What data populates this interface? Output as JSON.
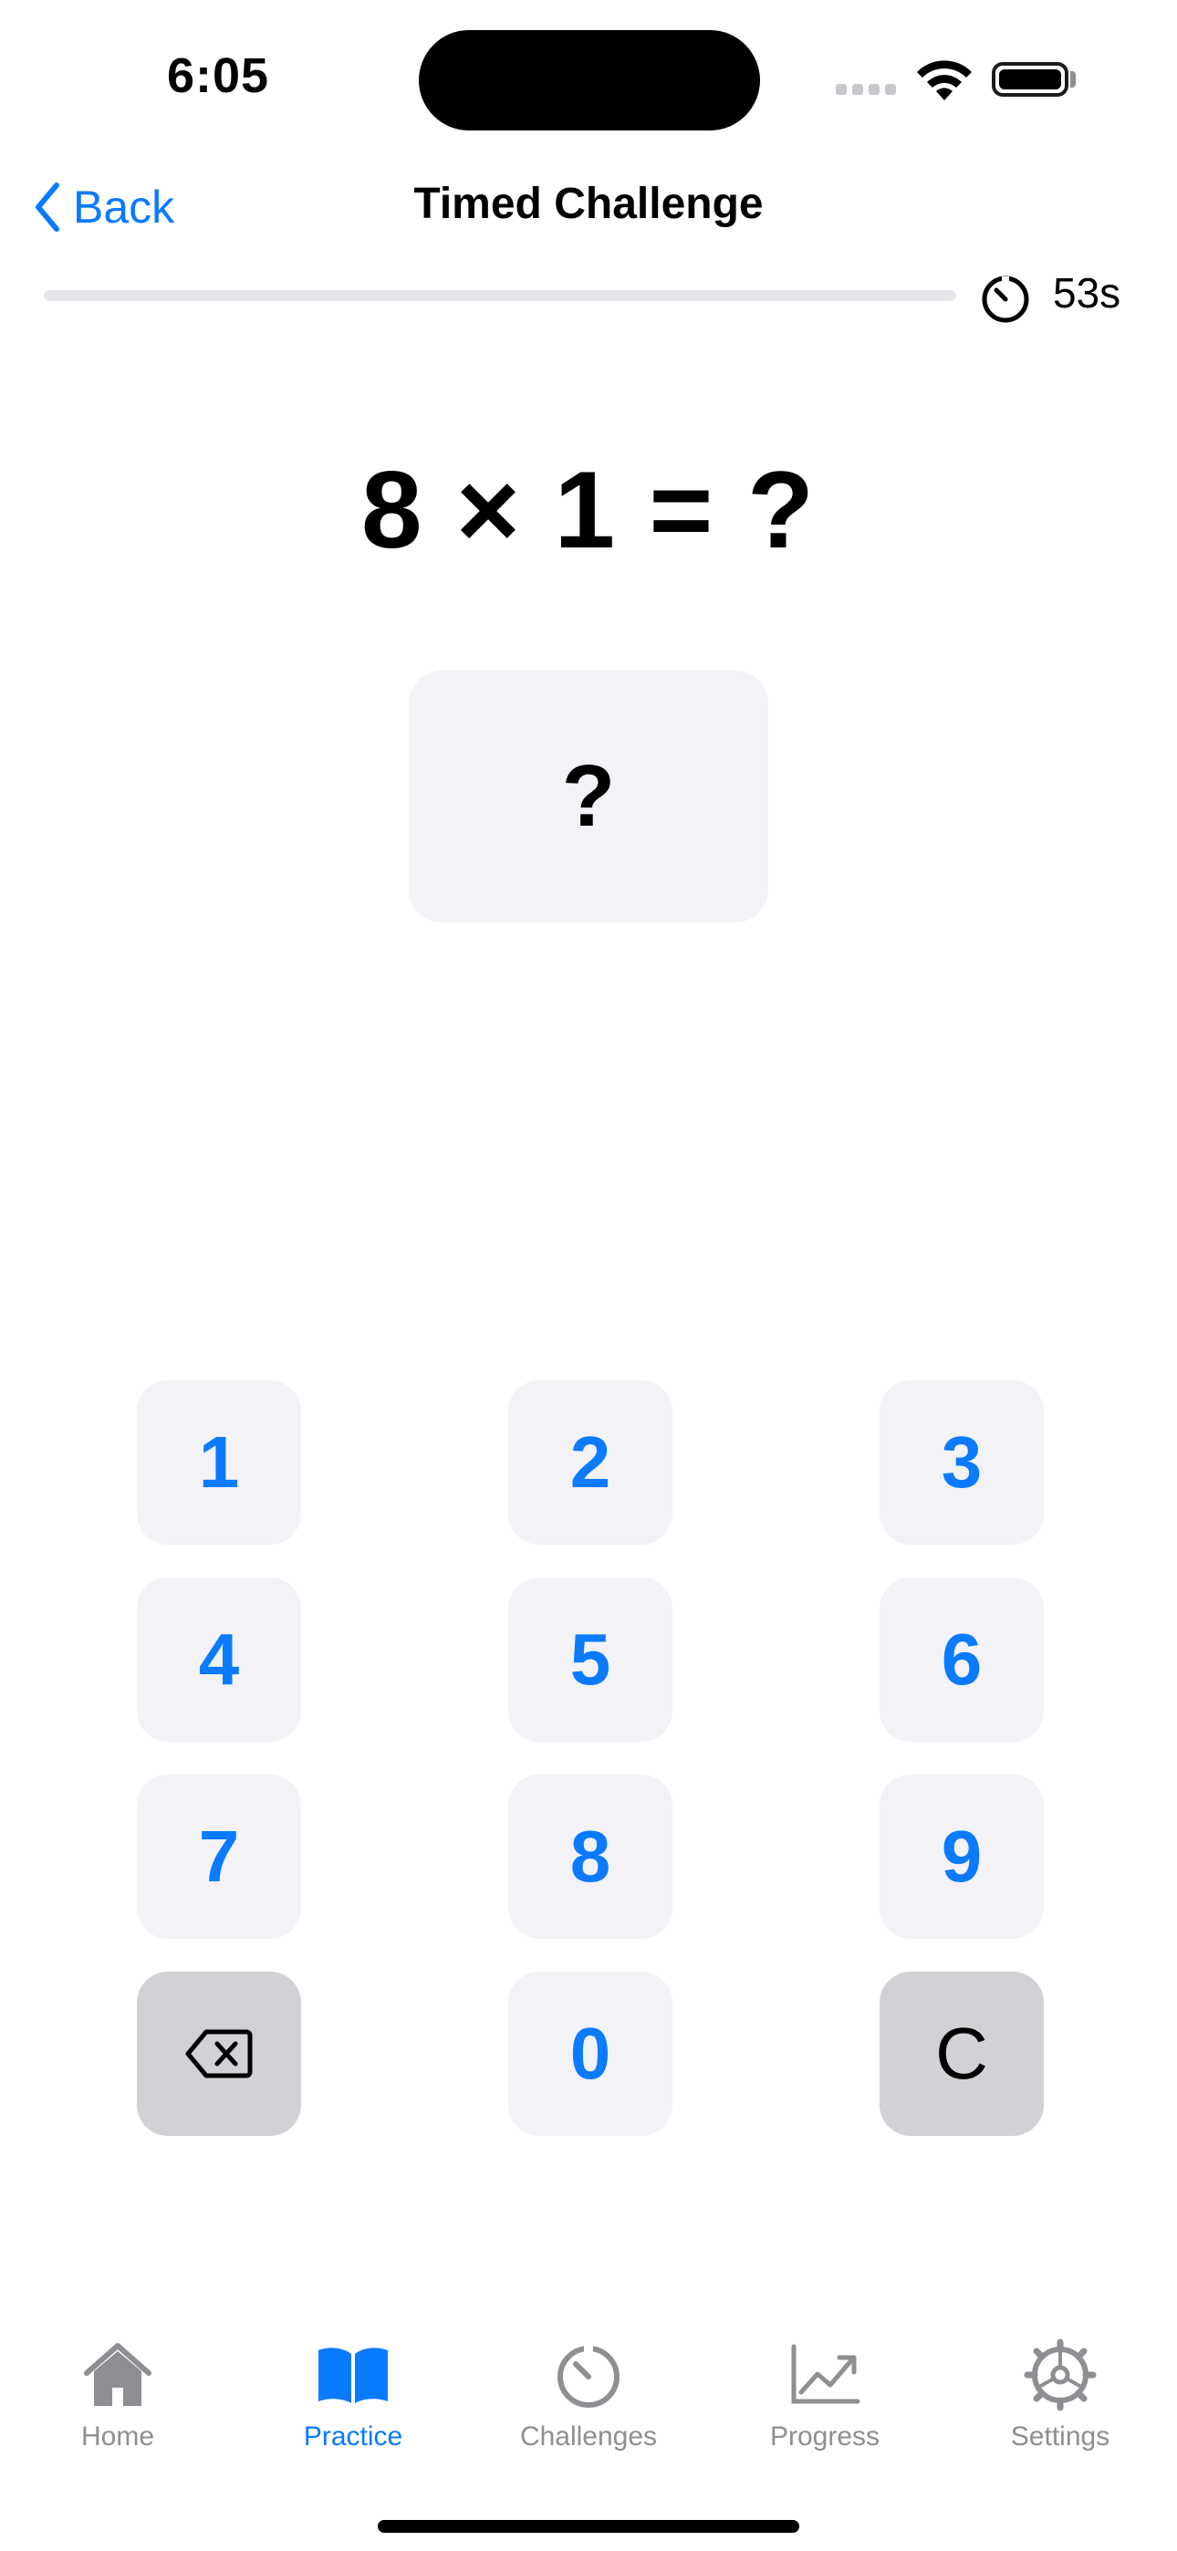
{
  "status_bar": {
    "time": "6:05"
  },
  "nav": {
    "back_label": "Back",
    "title": "Timed Challenge"
  },
  "timer": {
    "remaining": "53s",
    "progress_fraction": 0.0
  },
  "question": {
    "text": "8 × 1 = ?"
  },
  "answer": {
    "value": "?"
  },
  "keypad": {
    "keys": [
      "1",
      "2",
      "3",
      "4",
      "5",
      "6",
      "7",
      "8",
      "9",
      "0"
    ],
    "clear_label": "C",
    "backspace_icon": "delete-backward-icon"
  },
  "tabs": [
    {
      "label": "Home",
      "icon": "house-icon"
    },
    {
      "label": "Practice",
      "icon": "book-icon"
    },
    {
      "label": "Challenges",
      "icon": "timer-icon"
    },
    {
      "label": "Progress",
      "icon": "chart-line-icon"
    },
    {
      "label": "Settings",
      "icon": "gear-icon"
    }
  ],
  "colors": {
    "accent": "#0a7aff",
    "inactive": "#8e8e93",
    "key_bg": "#f2f2f7",
    "key_gray": "#d1d1d6"
  }
}
